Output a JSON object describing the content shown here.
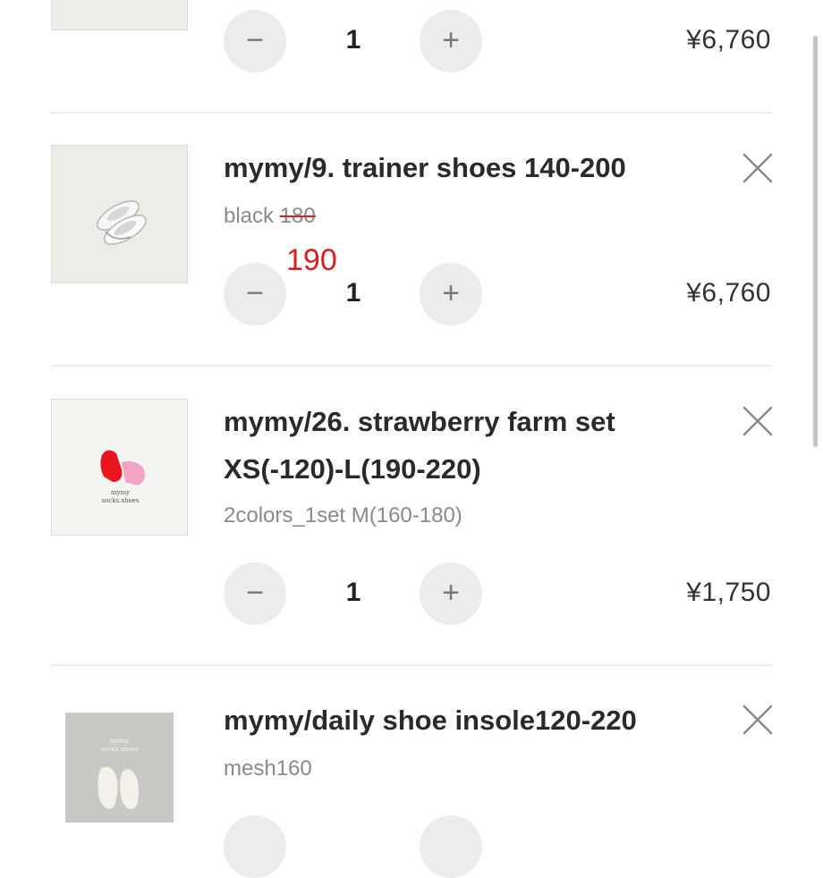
{
  "cart": {
    "items": [
      {
        "quantity": "1",
        "price": "¥6,760"
      },
      {
        "title": "mymy/9. trainer shoes 140-200",
        "variant_color": "black",
        "variant_size_old": "180",
        "correction_note": "190",
        "quantity": "1",
        "price": "¥6,760"
      },
      {
        "title_line1": "mymy/26. strawberry farm set",
        "title_line2": "XS(-120)-L(190-220)",
        "variant": "2colors_1set M(160-180)",
        "quantity": "1",
        "price": "¥1,750",
        "thumb_caption_line1": "mymy",
        "thumb_caption_line2": "socks.shoes"
      },
      {
        "title": "mymy/daily shoe insole120-220",
        "variant": "mesh160",
        "thumb_caption_line1": "mymy",
        "thumb_caption_line2": "socks.shoes"
      }
    ],
    "controls": {
      "minus": "−",
      "plus": "+"
    }
  },
  "colors": {
    "annotation_red": "#d81e1e",
    "button_bg": "#ececec",
    "divider": "#ececec"
  },
  "icons": {
    "remove": "close-icon",
    "decrease": "minus-icon",
    "increase": "plus-icon"
  }
}
